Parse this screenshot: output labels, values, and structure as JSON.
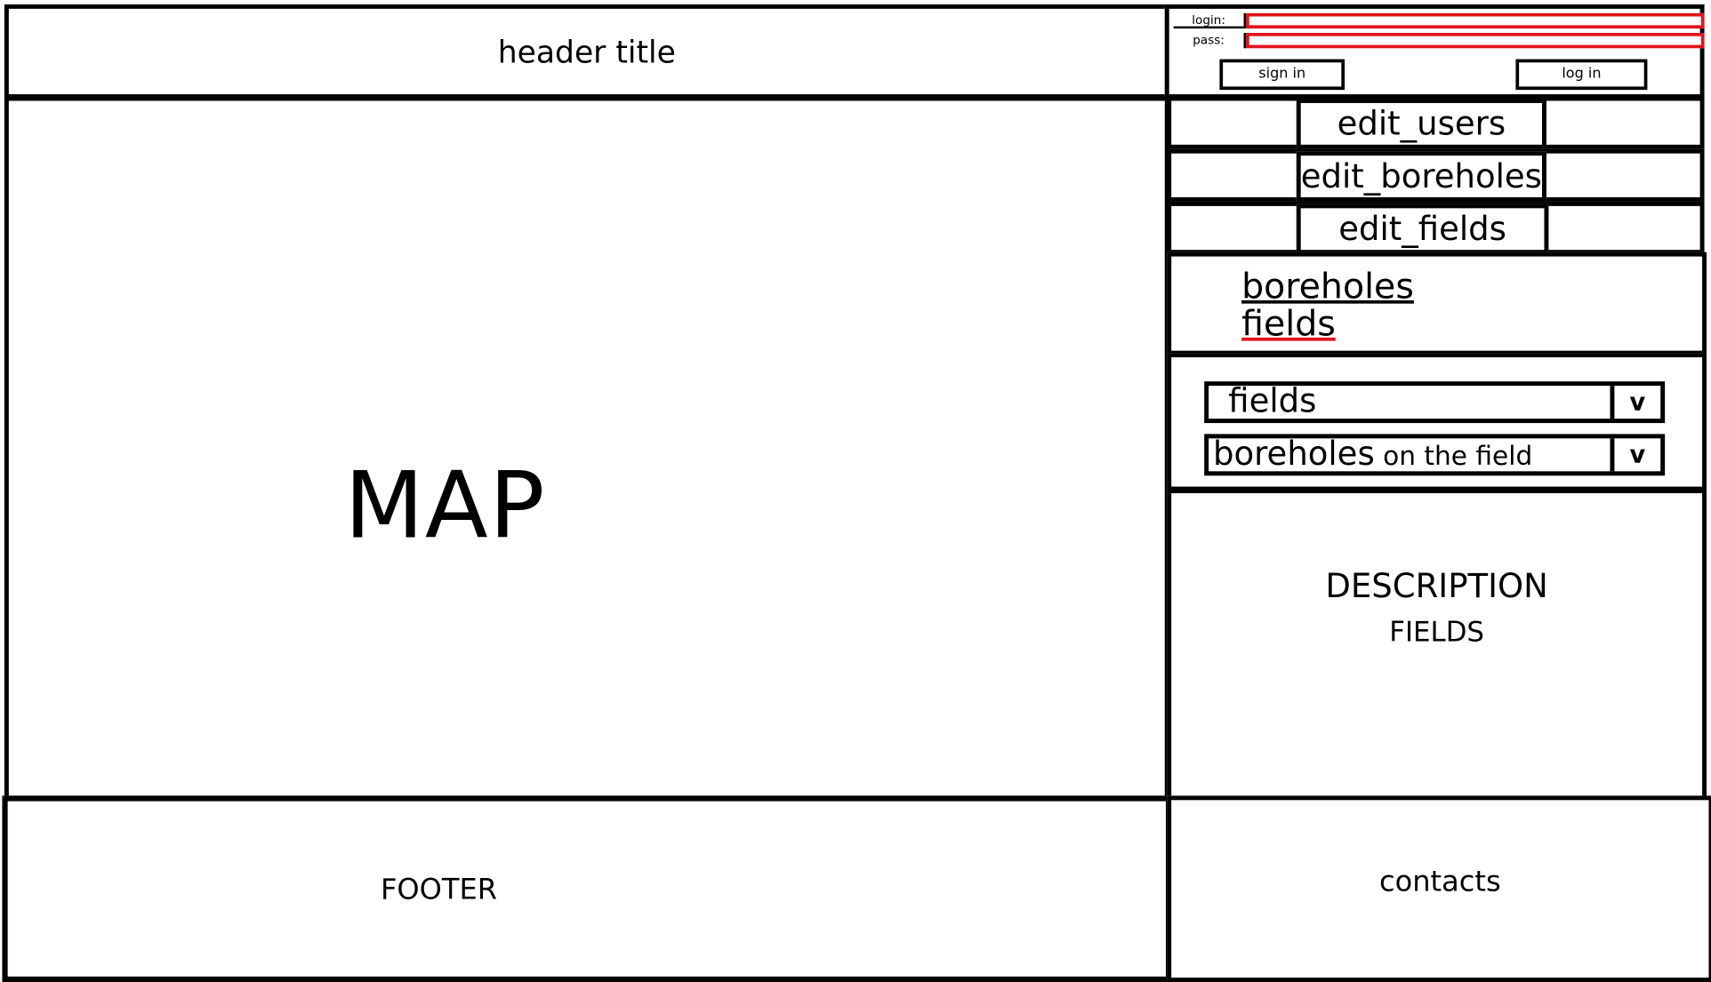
{
  "header": {
    "title": "header title"
  },
  "auth": {
    "login_label": "login:",
    "pass_label": "pass:",
    "login_value": "",
    "pass_value": "",
    "sign_in_label": "sign in",
    "log_in_label": "log in",
    "input_border_color": "#e0141c"
  },
  "map": {
    "label": "MAP"
  },
  "admin_nav": {
    "items": [
      {
        "label": "edit_users"
      },
      {
        "label": "edit_boreholes"
      },
      {
        "label": "edit_fields"
      }
    ]
  },
  "links": {
    "items": [
      {
        "label": "boreholes"
      },
      {
        "label": "fields"
      }
    ]
  },
  "selects": {
    "fields": {
      "selected": "fields",
      "arrow": "v"
    },
    "boreholes": {
      "selected_main": "boreholes",
      "selected_suffix": " on the field",
      "arrow": "v"
    }
  },
  "description": {
    "title": "DESCRIPTION",
    "subtitle": "FIELDS"
  },
  "footer": {
    "label": "FOOTER"
  },
  "contacts": {
    "label": "contacts"
  }
}
